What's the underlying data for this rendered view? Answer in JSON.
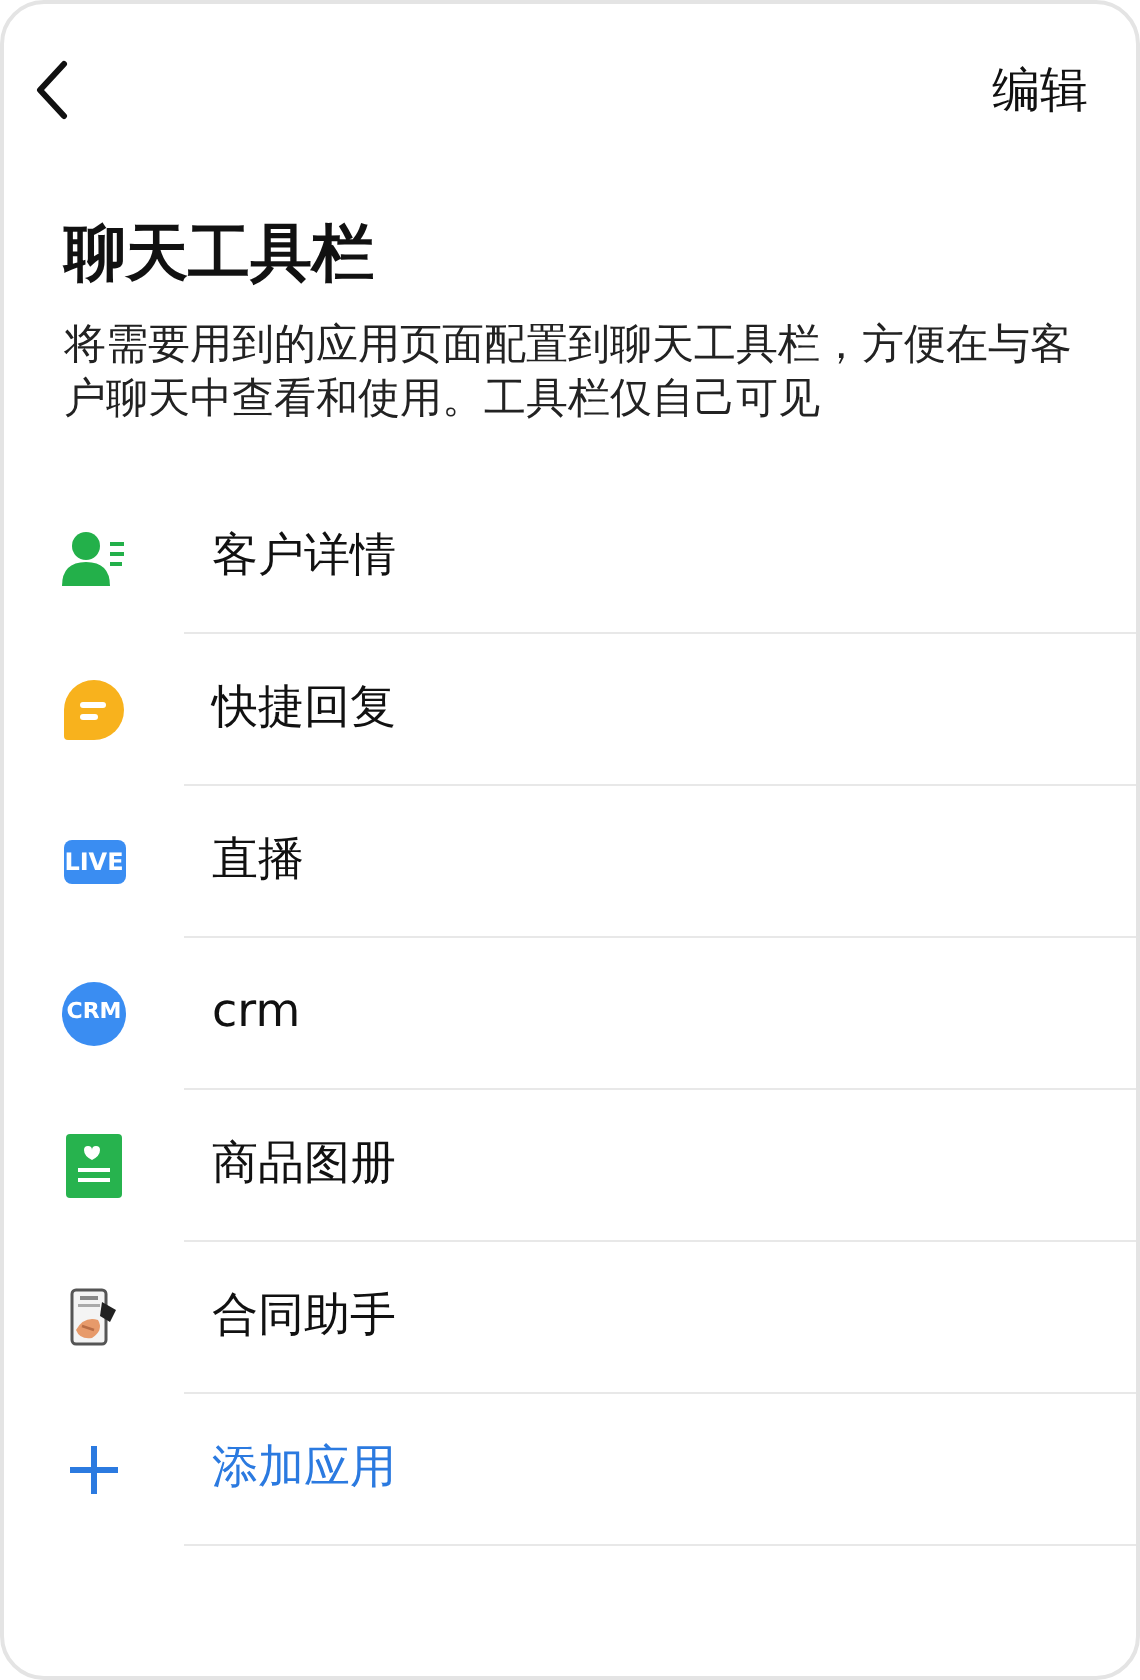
{
  "header": {
    "action": "编辑"
  },
  "title": "聊天工具栏",
  "description": "将需要用到的应用页面配置到聊天工具栏，方便在与客户聊天中查看和使用。工具栏仅自己可见",
  "items": [
    {
      "kind": "customer",
      "label": "客户详情"
    },
    {
      "kind": "reply",
      "label": "快捷回复"
    },
    {
      "kind": "live",
      "icon_text": "LIVE",
      "label": "直播"
    },
    {
      "kind": "crm",
      "icon_text": "CRM",
      "label": "crm"
    },
    {
      "kind": "catalog",
      "label": "商品图册"
    },
    {
      "kind": "contract",
      "label": "合同助手"
    },
    {
      "kind": "add",
      "label": "添加应用"
    }
  ]
}
